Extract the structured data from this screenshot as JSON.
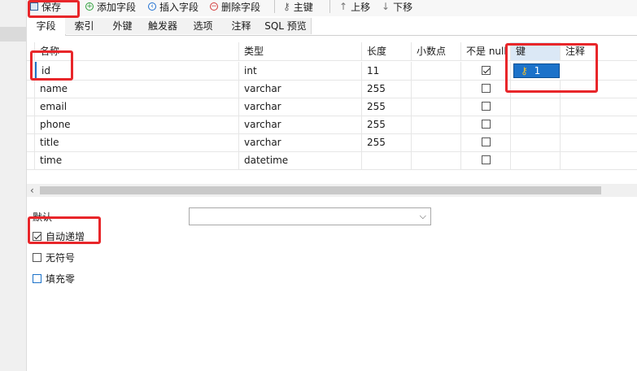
{
  "toolbar": {
    "save": "保存",
    "add_field": "添加字段",
    "insert_field": "插入字段",
    "delete_field": "删除字段",
    "primary_key": "主键",
    "move_up": "上移",
    "move_down": "下移"
  },
  "tabs": [
    "字段",
    "索引",
    "外键",
    "触发器",
    "选项",
    "注释",
    "SQL 预览"
  ],
  "columns": [
    "名称",
    "类型",
    "长度",
    "小数点",
    "不是 null",
    "键",
    "注释"
  ],
  "rows": [
    {
      "name": "id",
      "type": "int",
      "length": "11",
      "decimals": "",
      "not_null": true,
      "key": "1",
      "comment": ""
    },
    {
      "name": "name",
      "type": "varchar",
      "length": "255",
      "decimals": "",
      "not_null": false,
      "key": "",
      "comment": ""
    },
    {
      "name": "email",
      "type": "varchar",
      "length": "255",
      "decimals": "",
      "not_null": false,
      "key": "",
      "comment": ""
    },
    {
      "name": "phone",
      "type": "varchar",
      "length": "255",
      "decimals": "",
      "not_null": false,
      "key": "",
      "comment": ""
    },
    {
      "name": "title",
      "type": "varchar",
      "length": "255",
      "decimals": "",
      "not_null": false,
      "key": "",
      "comment": ""
    },
    {
      "name": "time",
      "type": "datetime",
      "length": "",
      "decimals": "",
      "not_null": false,
      "key": "",
      "comment": ""
    }
  ],
  "props": {
    "default_label": "默认",
    "auto_increment": {
      "label": "自动递增",
      "checked": true
    },
    "unsigned": {
      "label": "无符号",
      "checked": false
    },
    "zerofill": {
      "label": "填充零",
      "checked": false
    }
  },
  "colors": {
    "accent": "#1c72c9",
    "annotation": "#e8262a",
    "add": "#2e9e3a",
    "insert": "#1e6fd1",
    "delete": "#d33a3a"
  }
}
